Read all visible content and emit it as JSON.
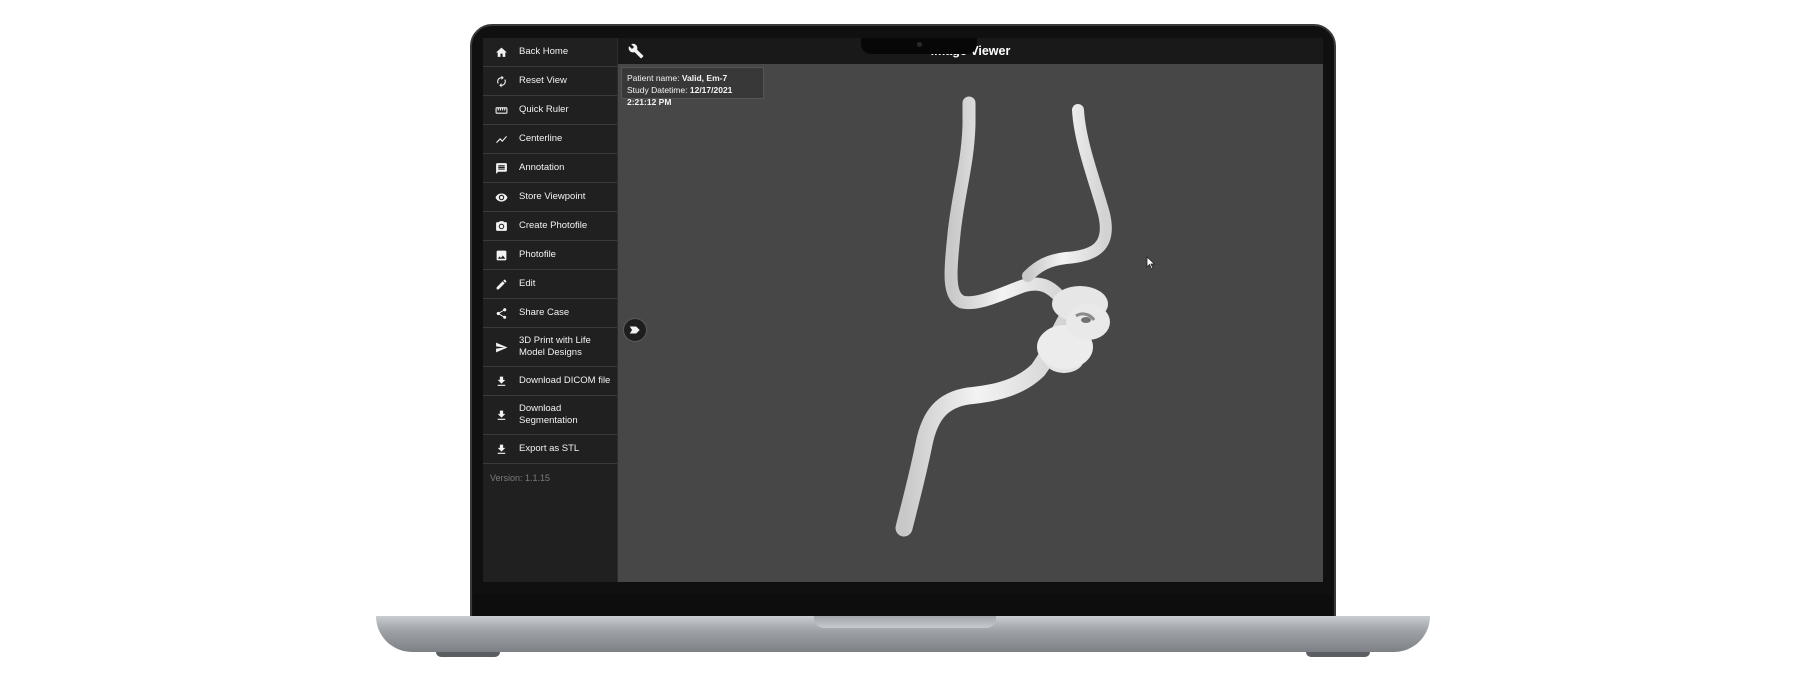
{
  "app": {
    "title": "Image Viewer",
    "version": "Version: 1.1.15"
  },
  "sidebar": {
    "items": [
      {
        "label": "Back Home",
        "icon": "home-icon"
      },
      {
        "label": "Reset View",
        "icon": "refresh-icon"
      },
      {
        "label": "Quick Ruler",
        "icon": "ruler-icon"
      },
      {
        "label": "Centerline",
        "icon": "line-chart-icon"
      },
      {
        "label": "Annotation",
        "icon": "comment-icon"
      },
      {
        "label": "Store Viewpoint",
        "icon": "eye-icon"
      },
      {
        "label": "Create Photofile",
        "icon": "camera-icon"
      },
      {
        "label": "Photofile",
        "icon": "image-icon"
      },
      {
        "label": "Edit",
        "icon": "pencil-icon"
      },
      {
        "label": "Share Case",
        "icon": "share-icon"
      },
      {
        "label": "3D Print with Life Model Designs",
        "icon": "send-icon"
      },
      {
        "label": "Download DICOM file",
        "icon": "download-icon"
      },
      {
        "label": "Download Segmentation",
        "icon": "download-icon"
      },
      {
        "label": "Export as STL",
        "icon": "download-icon"
      }
    ]
  },
  "patient": {
    "name_label": "Patient name:",
    "name_value": "Valid, Em-7",
    "date_label": "Study Datetime:",
    "date_value": "12/17/2021 2:21:12 PM"
  },
  "colors": {
    "viewport_bg": "#474747",
    "sidebar_bg": "#202020",
    "vessel": "#ededed"
  }
}
